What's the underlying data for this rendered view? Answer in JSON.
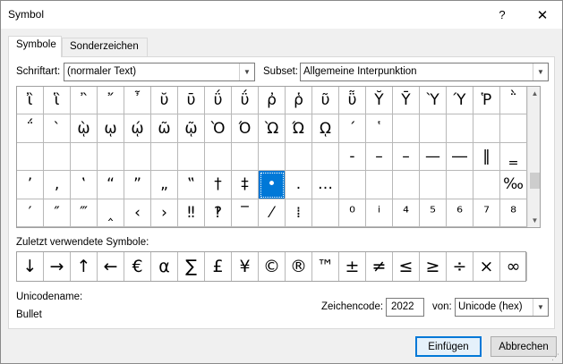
{
  "window": {
    "title": "Symbol",
    "help": "?",
    "close": "✕"
  },
  "tabs": [
    {
      "label": "Symbole",
      "active": true
    },
    {
      "label": "Sonderzeichen",
      "active": false
    }
  ],
  "font": {
    "label": "Schriftart:",
    "value": "(normaler Text)"
  },
  "subset": {
    "label": "Subset:",
    "value": "Allgemeine Interpunktion"
  },
  "symbol_grid": {
    "rows": [
      [
        "ἲ",
        "ἳ",
        "῍",
        "῎",
        "῏",
        "ῠ",
        "ῡ",
        "ΰ",
        "ΰ",
        "ῤ",
        "ῥ",
        "ῦ",
        "ῧ",
        "Ῠ",
        "Ῡ",
        "Ὺ",
        "Ύ",
        "Ῥ",
        "῭"
      ],
      [
        "΅",
        "`",
        "ῲ",
        "ῳ",
        "ῴ",
        "ῶ",
        "ῷ",
        "Ὸ",
        "Ό",
        "Ὼ",
        "Ώ",
        "ῼ",
        "´",
        "῾",
        "",
        "",
        "",
        "",
        ""
      ],
      [
        "",
        "",
        "",
        "",
        "",
        "",
        "",
        "",
        "",
        "",
        "",
        "",
        "-",
        "–",
        "–",
        "—",
        "―",
        "‖",
        "‗",
        "‘"
      ],
      [
        "’",
        "‚",
        "‛",
        "“",
        "”",
        "„",
        "‟",
        "†",
        "‡",
        "•",
        "․",
        "…",
        "",
        "",
        "",
        "",
        "",
        "",
        "‰"
      ],
      [
        "′",
        "″",
        "‴",
        "‸",
        "‹",
        "›",
        "‼",
        "‽",
        "‾",
        "⁄",
        "⁞",
        "",
        "⁰",
        "ⁱ",
        "⁴",
        "⁵",
        "⁶",
        "⁷",
        "⁸"
      ]
    ],
    "selected": "•"
  },
  "recent": {
    "label": "Zuletzt verwendete Symbole:",
    "items": [
      "↓",
      "→",
      "↑",
      "←",
      "€",
      "α",
      "∑",
      "£",
      "¥",
      "©",
      "®",
      "™",
      "±",
      "≠",
      "≤",
      "≥",
      "÷",
      "×",
      "∞"
    ]
  },
  "unicode": {
    "name_label": "Unicodename:",
    "name_value": "Bullet"
  },
  "charcode": {
    "label": "Zeichencode:",
    "value": "2022",
    "from_label": "von:",
    "from_value": "Unicode (hex)"
  },
  "buttons": {
    "insert": "Einfügen",
    "cancel": "Abbrechen"
  }
}
